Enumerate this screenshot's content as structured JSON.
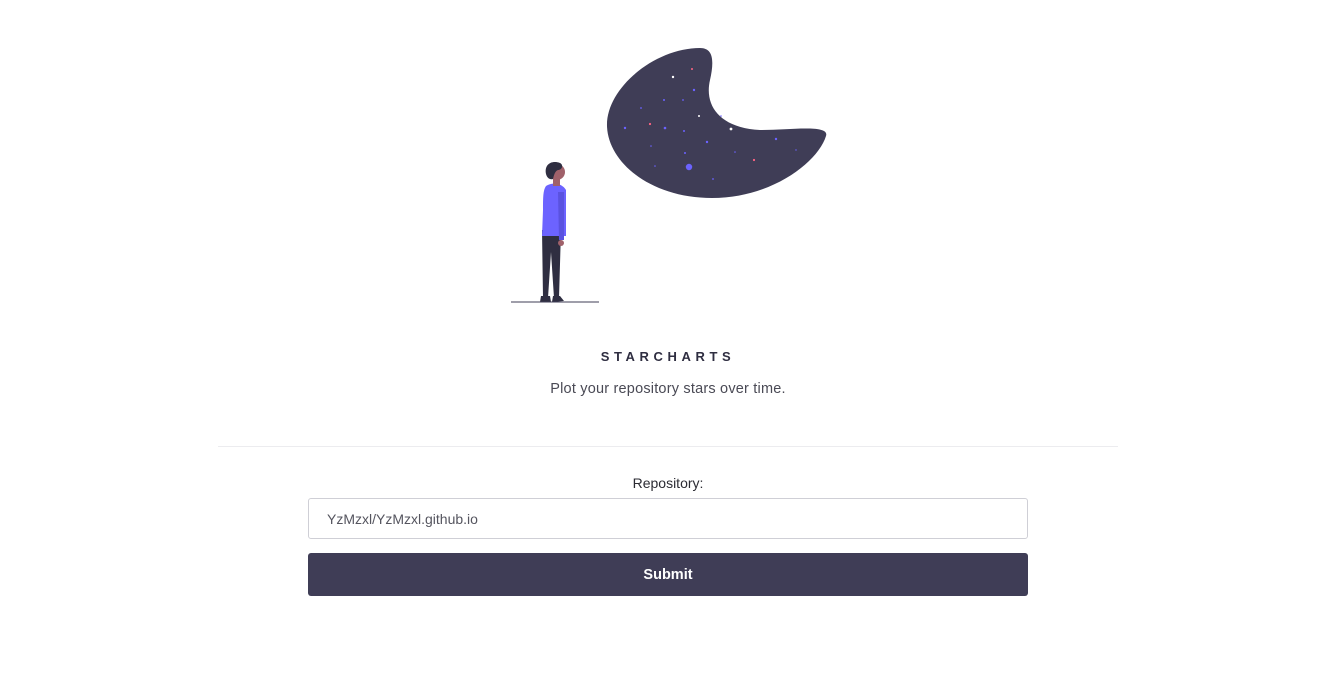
{
  "header": {
    "title": "STARCHARTS",
    "subtitle": "Plot your repository stars over time."
  },
  "illustration": {
    "name": "person-stargazing-illustration",
    "colors": {
      "sky_blob": "#3f3d56",
      "shirt": "#6c63ff",
      "pants": "#2f2e41",
      "skin": "#a0616a",
      "star_accent": "#ff6584"
    }
  },
  "form": {
    "label": "Repository:",
    "input_value": "YzMzxl/YzMzxl.github.io",
    "submit_label": "Submit"
  },
  "theme": {
    "primary": "#3f3d56",
    "background": "#ffffff"
  }
}
